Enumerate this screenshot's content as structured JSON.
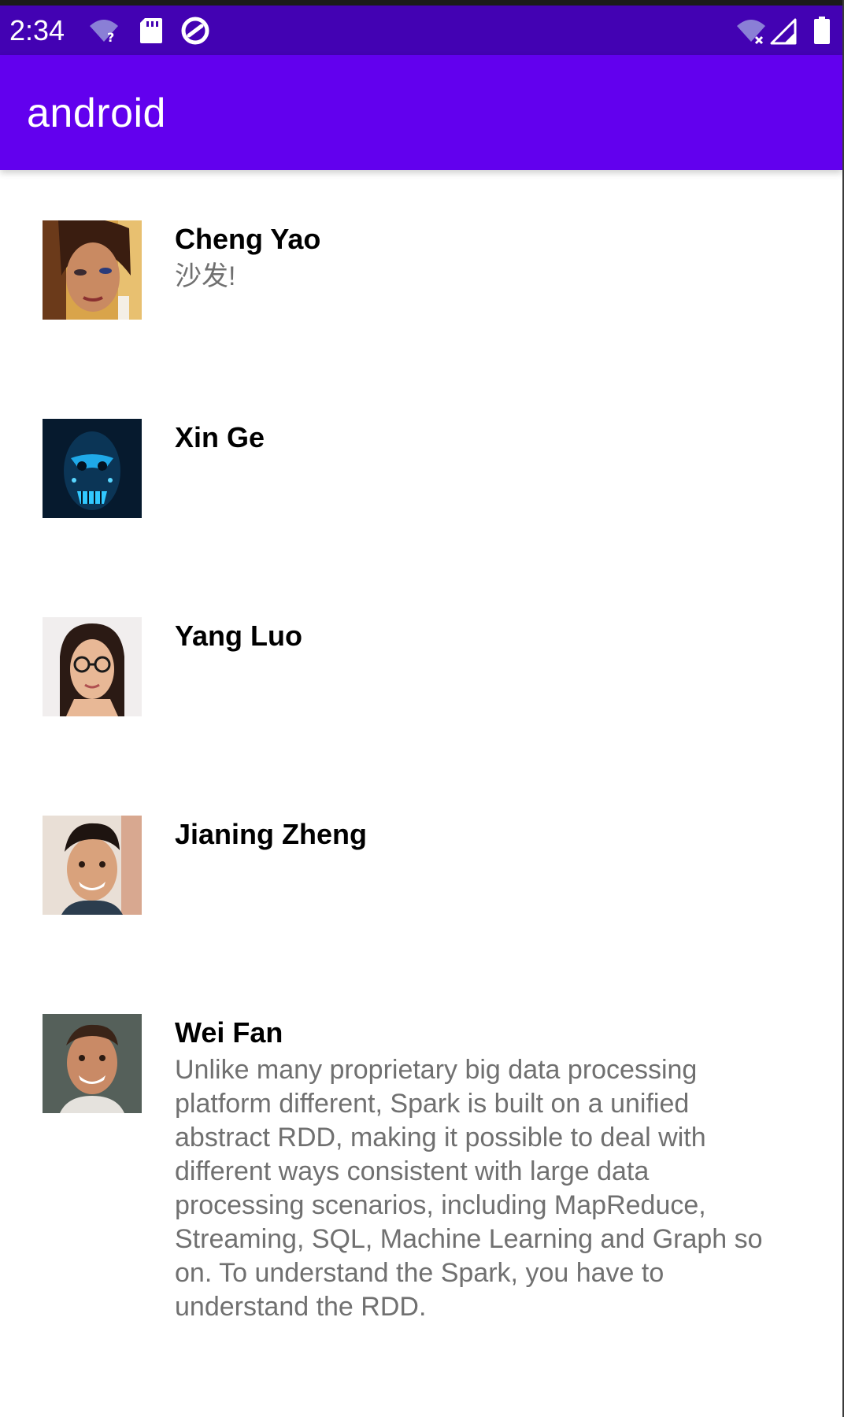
{
  "status_bar": {
    "time": "2:34",
    "icons_left": [
      "wifi-question-icon",
      "sd-card-icon",
      "do-not-disturb-icon"
    ],
    "icons_right": [
      "wifi-off-icon",
      "cell-signal-icon",
      "battery-icon"
    ],
    "background_color": "#4302b3"
  },
  "app_bar": {
    "title": "android",
    "background_color": "#6200ee"
  },
  "contacts": [
    {
      "name": "Cheng Yao",
      "message": "沙发!"
    },
    {
      "name": "Xin Ge",
      "message": ""
    },
    {
      "name": "Yang Luo",
      "message": ""
    },
    {
      "name": "Jianing Zheng",
      "message": ""
    },
    {
      "name": "Wei Fan",
      "message": "Unlike many proprietary big data processing platform different, Spark is built on a unified abstract RDD, making it possible to deal with different ways consistent with large data processing scenarios, including MapReduce, Streaming, SQL, Machine Learning and Graph so on. To understand the Spark, you have to understand the RDD."
    }
  ]
}
